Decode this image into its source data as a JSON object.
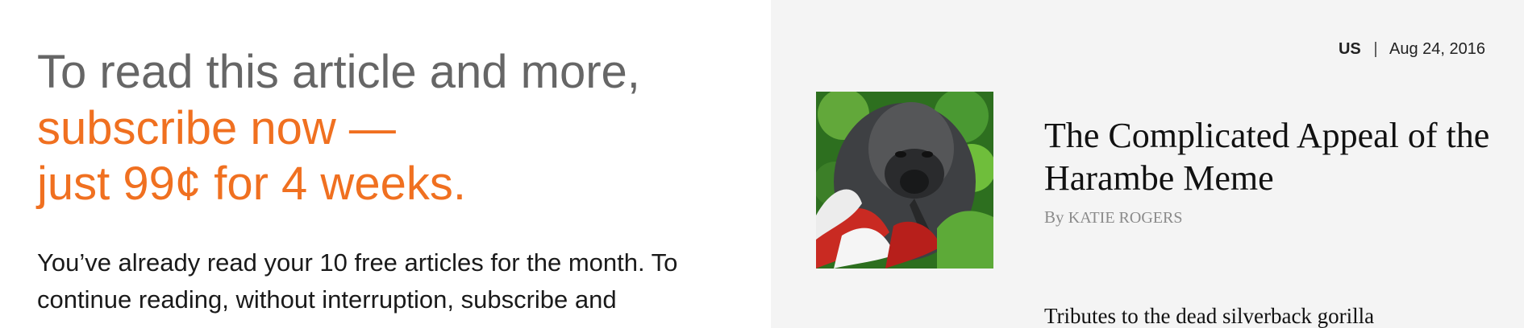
{
  "left_panel": {
    "headline_line1": "To read this article and more,",
    "headline_line2": "subscribe now —",
    "headline_line3": "just 99¢ for 4 weeks.",
    "body_text": "You’ve already read your 10 free articles for the month. To continue reading, without interruption, subscribe and"
  },
  "article": {
    "section": "US",
    "separator": "|",
    "date": "Aug 24, 2016",
    "title": "The Complicated Appeal of the Harambe Meme",
    "byline_prefix": "By",
    "byline_author": "KATIE ROGERS",
    "summary": "Tributes to the dead silverback gorilla",
    "image_subject": "gorilla-photo"
  },
  "colors": {
    "headline_gray": "#666666",
    "accent_orange": "#f07020",
    "right_panel_bg": "#f4f4f4"
  }
}
